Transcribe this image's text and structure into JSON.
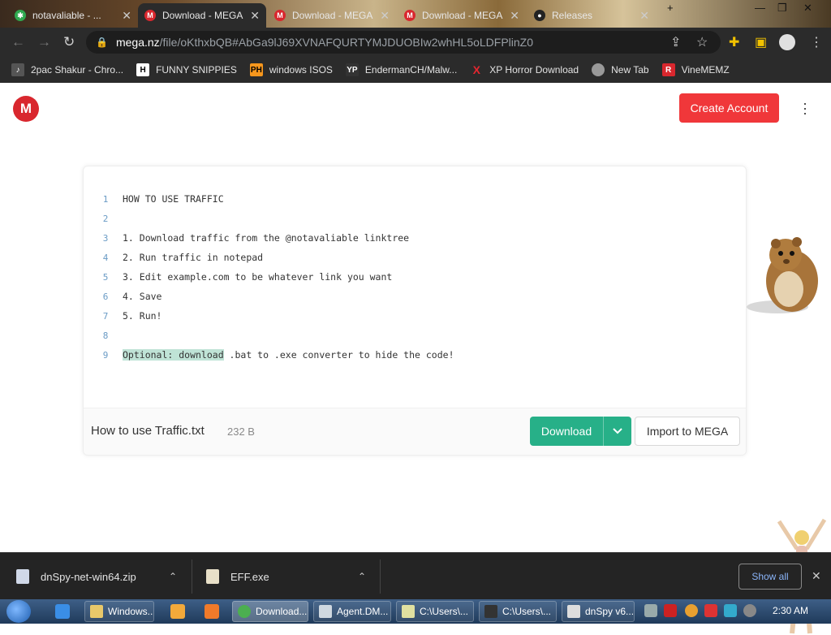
{
  "browser": {
    "tabs": [
      {
        "title": "notavaliable - ...",
        "active": false
      },
      {
        "title": "Download - MEGA",
        "active": true
      },
      {
        "title": "Download - MEGA",
        "active": false
      },
      {
        "title": "Download - MEGA",
        "active": false
      },
      {
        "title": "Releases",
        "active": false
      }
    ],
    "url_host": "mega.nz",
    "url_path": "/file/oKthxbQB#AbGa9lJ69XVNAFQURTYMJDUOBIw2whHL5oLDFPlinZ0"
  },
  "bookmarks": [
    {
      "label": "2pac Shakur - Chro...",
      "icon": "sound-icon",
      "color": "#e8e8e8"
    },
    {
      "label": "FUNNY SNIPPIES",
      "icon": "H",
      "color": "#ffffff"
    },
    {
      "label": "windows ISOS",
      "icon": "PH",
      "color": "#f7971d"
    },
    {
      "label": "EndermanCH/Malw...",
      "icon": "YP",
      "color": "#333333"
    },
    {
      "label": "XP Horror Download",
      "icon": "X",
      "color": "#e3262f"
    },
    {
      "label": "New Tab",
      "icon": "globe-icon",
      "color": "#888888"
    },
    {
      "label": "VineMEMZ",
      "icon": "R",
      "color": "#d9272e"
    }
  ],
  "header": {
    "logo_letter": "M",
    "create_account": "Create Account"
  },
  "file": {
    "lines": [
      {
        "n": "1",
        "text": "HOW TO USE TRAFFIC"
      },
      {
        "n": "2",
        "text": ""
      },
      {
        "n": "3",
        "text": "1. Download traffic from the @notavaliable linktree"
      },
      {
        "n": "4",
        "text": "2. Run traffic in notepad"
      },
      {
        "n": "5",
        "text": "3. Edit example.com to be whatever link you want"
      },
      {
        "n": "6",
        "text": "4. Save"
      },
      {
        "n": "7",
        "text": "5. Run!"
      },
      {
        "n": "8",
        "text": ""
      },
      {
        "n": "9",
        "highlight": "Optional: download",
        "text": " .bat to .exe converter to hide the code!"
      }
    ],
    "name": "How to use Traffic.txt",
    "size": "232 B",
    "download_label": "Download",
    "import_label": "Import to MEGA"
  },
  "downloads": [
    {
      "name": "dnSpy-net-win64.zip"
    },
    {
      "name": "EFF.exe"
    }
  ],
  "show_all": "Show all",
  "taskbar": {
    "tasks": [
      "Windows...",
      "Download...",
      "Agent.DM...",
      "C:\\Users\\...",
      "C:\\Users\\...",
      "dnSpy v6...."
    ],
    "clock": "2:30 AM"
  },
  "colors": {
    "mega_red": "#d9272e",
    "create_btn": "#f0373a",
    "download_green": "#27b088"
  }
}
